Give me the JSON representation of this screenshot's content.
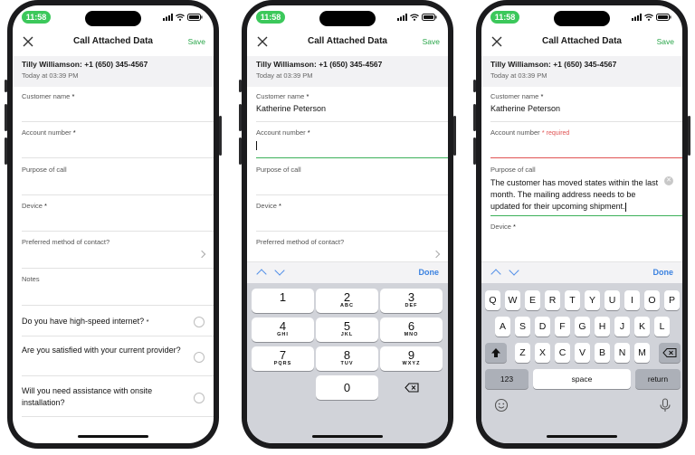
{
  "status": {
    "time": "11:58"
  },
  "nav": {
    "title": "Call Attached Data",
    "save_label": "Save"
  },
  "caller": {
    "name": "Tilly Williamson: +1 (650) 345-4567",
    "time": "Today at 03:39 PM"
  },
  "labels": {
    "customer_name": "Customer name",
    "account_number": "Account number",
    "purpose_of_call": "Purpose of call",
    "device": "Device",
    "preferred_contact": "Preferred method of contact?",
    "notes": "Notes",
    "required_marker": "*",
    "required_text": "required"
  },
  "values": {
    "customer_name": "Katherine Peterson",
    "purpose_of_call": "The customer has moved states within the last month. The mailing address needs to be updated for their upcoming shipment."
  },
  "questions": [
    {
      "text": "Do you have high-speed internet?",
      "required": "*"
    },
    {
      "text": "Are you satisfied with your current provider?"
    },
    {
      "text": "Will you need assistance with onsite installation?"
    }
  ],
  "accessory": {
    "done_label": "Done"
  },
  "numpad": [
    {
      "num": "1",
      "letters": ""
    },
    {
      "num": "2",
      "letters": "ABC"
    },
    {
      "num": "3",
      "letters": "DEF"
    },
    {
      "num": "4",
      "letters": "GHI"
    },
    {
      "num": "5",
      "letters": "JKL"
    },
    {
      "num": "6",
      "letters": "MNO"
    },
    {
      "num": "7",
      "letters": "PQRS"
    },
    {
      "num": "8",
      "letters": "TUV"
    },
    {
      "num": "9",
      "letters": "WXYZ"
    },
    {
      "num": "0",
      "letters": ""
    }
  ],
  "keyboard": {
    "row1": [
      "Q",
      "W",
      "E",
      "R",
      "T",
      "Y",
      "U",
      "I",
      "O",
      "P"
    ],
    "row2": [
      "A",
      "S",
      "D",
      "F",
      "G",
      "H",
      "J",
      "K",
      "L"
    ],
    "row3": [
      "Z",
      "X",
      "C",
      "V",
      "B",
      "N",
      "M"
    ],
    "numbers_label": "123",
    "space_label": "space",
    "return_label": "return"
  },
  "colors": {
    "accent_green": "#2aa64a",
    "done_blue": "#3b82e0",
    "error_red": "#e05353"
  }
}
